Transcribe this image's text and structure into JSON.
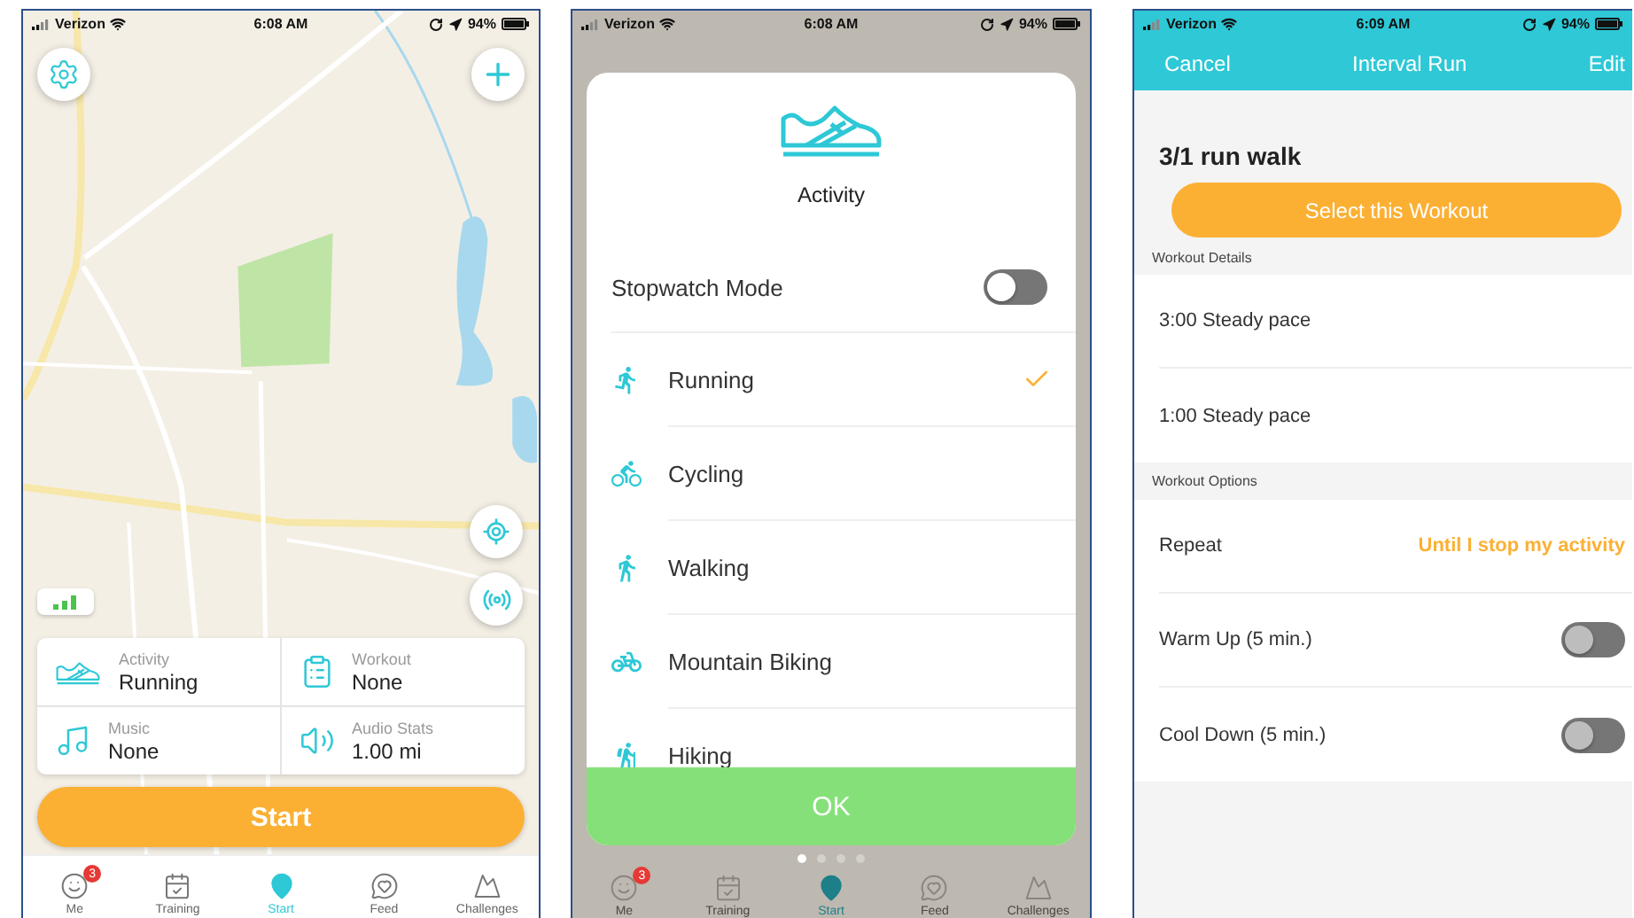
{
  "phones": [
    {
      "kind": "map",
      "status_bar": {
        "carrier": "Verizon",
        "time": "6:08 AM",
        "battery": "94%"
      },
      "activity_card": [
        {
          "label": "Activity",
          "value": "Running"
        },
        {
          "label": "Workout",
          "value": "None"
        },
        {
          "label": "Music",
          "value": "None"
        },
        {
          "label": "Audio Stats",
          "value": "1.00 mi"
        }
      ],
      "start_button": "Start",
      "tab_bar": [
        {
          "label": "Me",
          "selected": false,
          "badge": "3"
        },
        {
          "label": "Training",
          "selected": false
        },
        {
          "label": "Start",
          "selected": true
        },
        {
          "label": "Feed",
          "selected": false
        },
        {
          "label": "Challenges",
          "selected": false
        }
      ]
    },
    {
      "kind": "activity_picker",
      "status_bar": {
        "carrier": "Verizon",
        "time": "6:08 AM",
        "battery": "94%"
      },
      "title": "Activity",
      "stopwatch": {
        "label": "Stopwatch Mode",
        "on": false
      },
      "activities": [
        {
          "label": "Running",
          "selected": true
        },
        {
          "label": "Cycling",
          "selected": false
        },
        {
          "label": "Walking",
          "selected": false
        },
        {
          "label": "Mountain Biking",
          "selected": false
        },
        {
          "label": "Hiking",
          "selected": false
        }
      ],
      "ok_button": "OK",
      "page_dots": [
        {
          "selected": true
        },
        {
          "selected": false
        },
        {
          "selected": false
        },
        {
          "selected": false
        }
      ],
      "tab_bar": [
        {
          "label": "Me",
          "selected": false,
          "badge": "3"
        },
        {
          "label": "Training",
          "selected": false
        },
        {
          "label": "Start",
          "selected": true
        },
        {
          "label": "Feed",
          "selected": false
        },
        {
          "label": "Challenges",
          "selected": false
        }
      ]
    },
    {
      "kind": "workout",
      "status_bar": {
        "carrier": "Verizon",
        "time": "6:09 AM",
        "battery": "94%"
      },
      "nav": {
        "cancel": "Cancel",
        "title": "Interval Run",
        "edit": "Edit"
      },
      "workout_name": "3/1 run walk",
      "select_button": "Select this Workout",
      "details_header": "Workout Details",
      "details": [
        "3:00 Steady pace",
        "1:00 Steady pace"
      ],
      "options_header": "Workout Options",
      "options": [
        {
          "kind": "value",
          "label": "Repeat",
          "value": "Until I stop my activity"
        },
        {
          "kind": "toggle",
          "label": "Warm Up (5 min.)",
          "on": false
        },
        {
          "kind": "toggle",
          "label": "Cool Down (5 min.)",
          "on": false
        }
      ]
    }
  ]
}
